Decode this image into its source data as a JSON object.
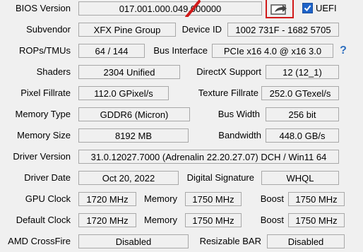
{
  "rows": {
    "bios": {
      "label": "BIOS Version",
      "value": "017.001.000.049.000000",
      "uefi_label": "UEFI",
      "uefi_checked": true,
      "share_icon": "share-export-icon"
    },
    "subvendor": {
      "label": "Subvendor",
      "value": "XFX Pine Group",
      "label2": "Device ID",
      "value2": "1002 731F - 1682 5705"
    },
    "rops": {
      "label": "ROPs/TMUs",
      "value": "64 / 144",
      "label2": "Bus Interface",
      "value2": "PCIe x16 4.0 @ x16 3.0",
      "help": "?"
    },
    "shaders": {
      "label": "Shaders",
      "value": "2304 Unified",
      "label2": "DirectX Support",
      "value2": "12 (12_1)"
    },
    "pixel": {
      "label": "Pixel Fillrate",
      "value": "112.0 GPixel/s",
      "label2": "Texture Fillrate",
      "value2": "252.0 GTexel/s"
    },
    "memtype": {
      "label": "Memory Type",
      "value": "GDDR6 (Micron)",
      "label2": "Bus Width",
      "value2": "256 bit"
    },
    "memsize": {
      "label": "Memory Size",
      "value": "8192 MB",
      "label2": "Bandwidth",
      "value2": "448.0 GB/s"
    },
    "driver": {
      "label": "Driver Version",
      "value": "31.0.12027.7000 (Adrenalin 22.20.27.07) DCH / Win11 64"
    },
    "driverdate": {
      "label": "Driver Date",
      "value": "Oct 20, 2022",
      "label2": "Digital Signature",
      "value2": "WHQL"
    },
    "gpuclock": {
      "label": "GPU Clock",
      "value": "1720 MHz",
      "mem_label": "Memory",
      "mem_value": "1750 MHz",
      "boost_label": "Boost",
      "boost_value": "1750 MHz"
    },
    "defclock": {
      "label": "Default Clock",
      "value": "1720 MHz",
      "mem_label": "Memory",
      "mem_value": "1750 MHz",
      "boost_label": "Boost",
      "boost_value": "1750 MHz"
    },
    "crossfire": {
      "label": "AMD CrossFire",
      "value": "Disabled",
      "label2": "Resizable BAR",
      "value2": "Disabled"
    }
  },
  "colors": {
    "highlight": "#d11a1a",
    "checkbox": "#1e63c8",
    "help": "#2f6fbf"
  }
}
